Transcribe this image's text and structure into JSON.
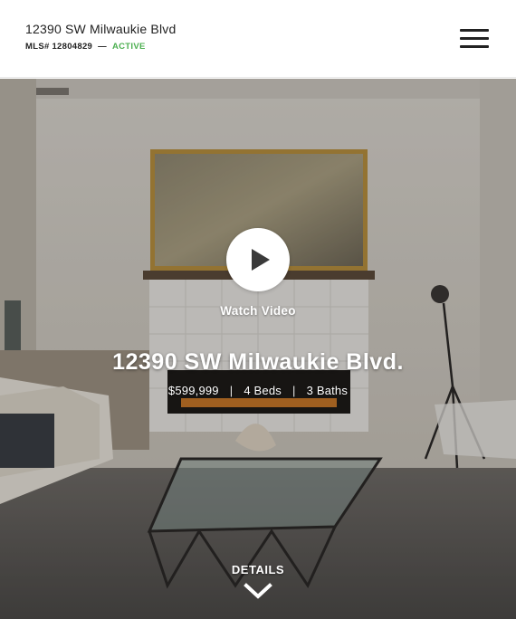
{
  "header": {
    "address": "12390 SW Milwaukie Blvd",
    "mls_label": "MLS# 12804829",
    "separator": "—",
    "status": "ACTIVE",
    "status_color": "#4caf50",
    "menu_icon": "hamburger-menu-icon"
  },
  "hero": {
    "play_icon": "play-icon",
    "watch_label": "Watch Video",
    "title": "12390 SW Milwaukie Blvd.",
    "price": "$599,999",
    "beds": "4 Beds",
    "baths": "3 Baths",
    "pipe": "|",
    "details_label": "DETAILS",
    "details_icon": "chevron-down-icon"
  }
}
